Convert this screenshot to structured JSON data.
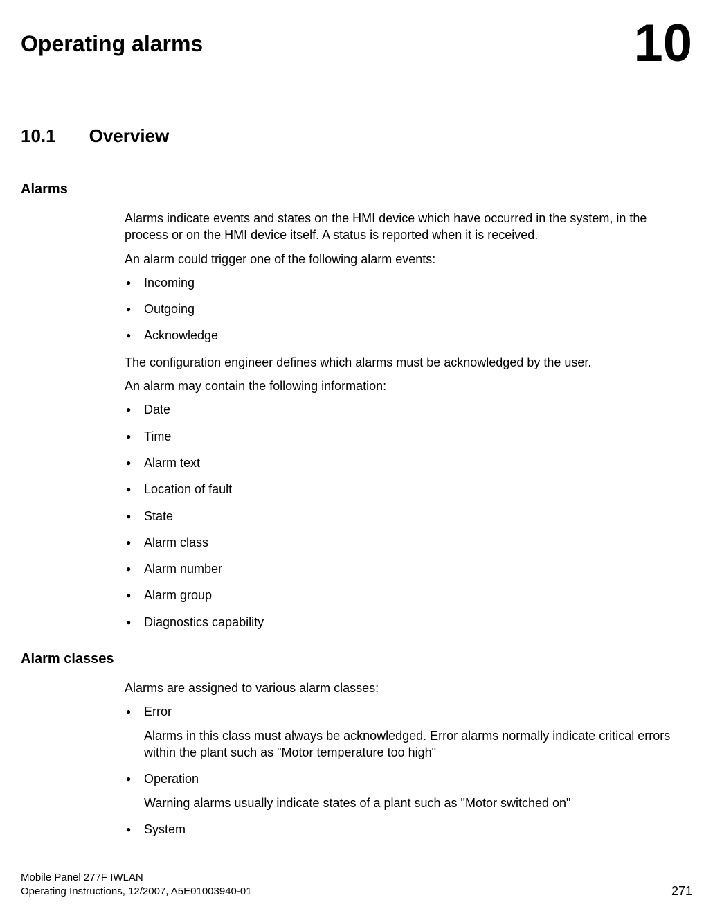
{
  "header": {
    "chapter_title": "Operating alarms",
    "chapter_number": "10"
  },
  "section": {
    "number": "10.1",
    "title": "Overview"
  },
  "alarms": {
    "heading": "Alarms",
    "p1": "Alarms indicate events and states on the HMI device which have occurred in the system, in the process or on the HMI device itself. A status is reported when it is received.",
    "p2": "An alarm could trigger one of the following alarm events:",
    "events": [
      "Incoming",
      "Outgoing",
      "Acknowledge"
    ],
    "p3": "The configuration engineer defines which alarms must be acknowledged by the user.",
    "p4": "An alarm may contain the following information:",
    "info": [
      "Date",
      "Time",
      "Alarm text",
      "Location of fault",
      "State",
      "Alarm class",
      "Alarm number",
      "Alarm group",
      "Diagnostics capability"
    ]
  },
  "alarm_classes": {
    "heading": "Alarm classes",
    "p1": "Alarms are assigned to various alarm classes:",
    "items": [
      {
        "label": "Error",
        "desc": "Alarms in this class must always be acknowledged. Error alarms normally indicate critical errors within the plant such as \"Motor temperature too high\""
      },
      {
        "label": "Operation",
        "desc": "Warning alarms usually indicate states of a plant such as \"Motor switched on\""
      },
      {
        "label": "System",
        "desc": ""
      }
    ]
  },
  "footer": {
    "line1": "Mobile Panel 277F IWLAN",
    "line2": "Operating Instructions, 12/2007, A5E01003940-01",
    "page": "271"
  }
}
